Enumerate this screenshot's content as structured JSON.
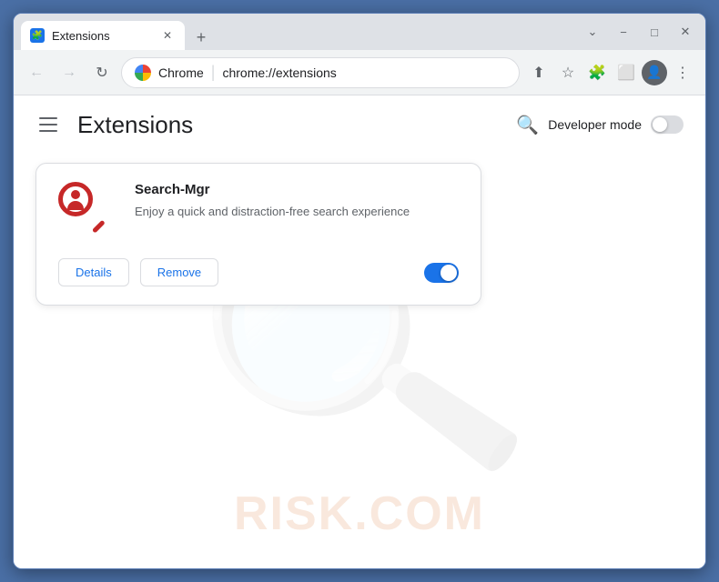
{
  "browser": {
    "tab_title": "Extensions",
    "tab_favicon": "🧩",
    "new_tab_label": "+",
    "address_bar": {
      "brand": "Chrome",
      "url": "chrome://extensions"
    },
    "window_controls": {
      "minimize": "−",
      "maximize": "□",
      "close": "✕",
      "chevron_down": "⌄"
    },
    "nav": {
      "back": "←",
      "forward": "→",
      "reload": "↻"
    },
    "toolbar_icons": {
      "share": "⬆",
      "bookmark": "☆",
      "extensions": "🧩",
      "split": "⬜",
      "profile": "👤",
      "menu": "⋮"
    }
  },
  "page": {
    "hamburger_label": "☰",
    "title": "Extensions",
    "search_icon": "🔍",
    "developer_mode_label": "Developer mode"
  },
  "extension": {
    "name": "Search-Mgr",
    "description": "Enjoy a quick and distraction-free search experience",
    "details_button": "Details",
    "remove_button": "Remove",
    "enabled": true
  },
  "watermark": {
    "text": "RISK.COM"
  }
}
